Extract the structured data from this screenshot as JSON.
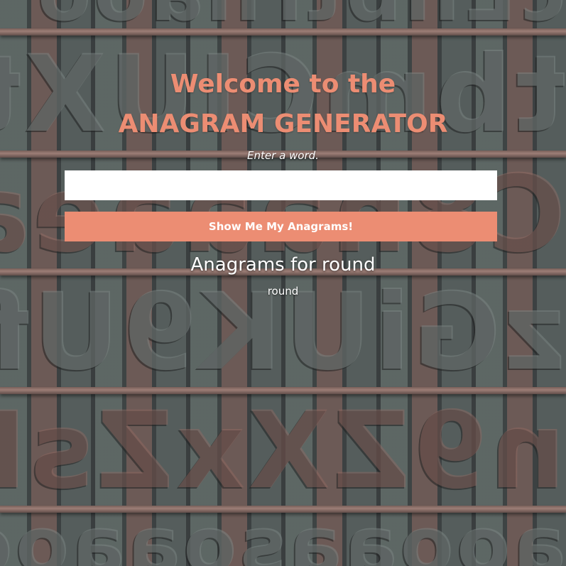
{
  "page": {
    "title_line1": "Welcome to the",
    "title_line2": "ANAGRAM GENERATOR",
    "prompt": "Enter a word.",
    "input_value": "",
    "input_placeholder": "",
    "submit_label": "Show Me My Anagrams!",
    "results_heading": "Anagrams for round",
    "results": [
      "round"
    ]
  },
  "theme": {
    "accent": "#ec8d73",
    "text": "#ffffff",
    "input_bg": "#ffffff"
  },
  "background": {
    "description_type": "wood-type-letterpress",
    "rows": [
      "tbmCIUXtJUnoIIot",
      "C8naaaeatK0AS",
      "zGiUK9Uflu6u",
      "n9ZXxZsIrC8It",
      "aooaasoaaoo",
      "cEhbtrnaoo"
    ]
  }
}
